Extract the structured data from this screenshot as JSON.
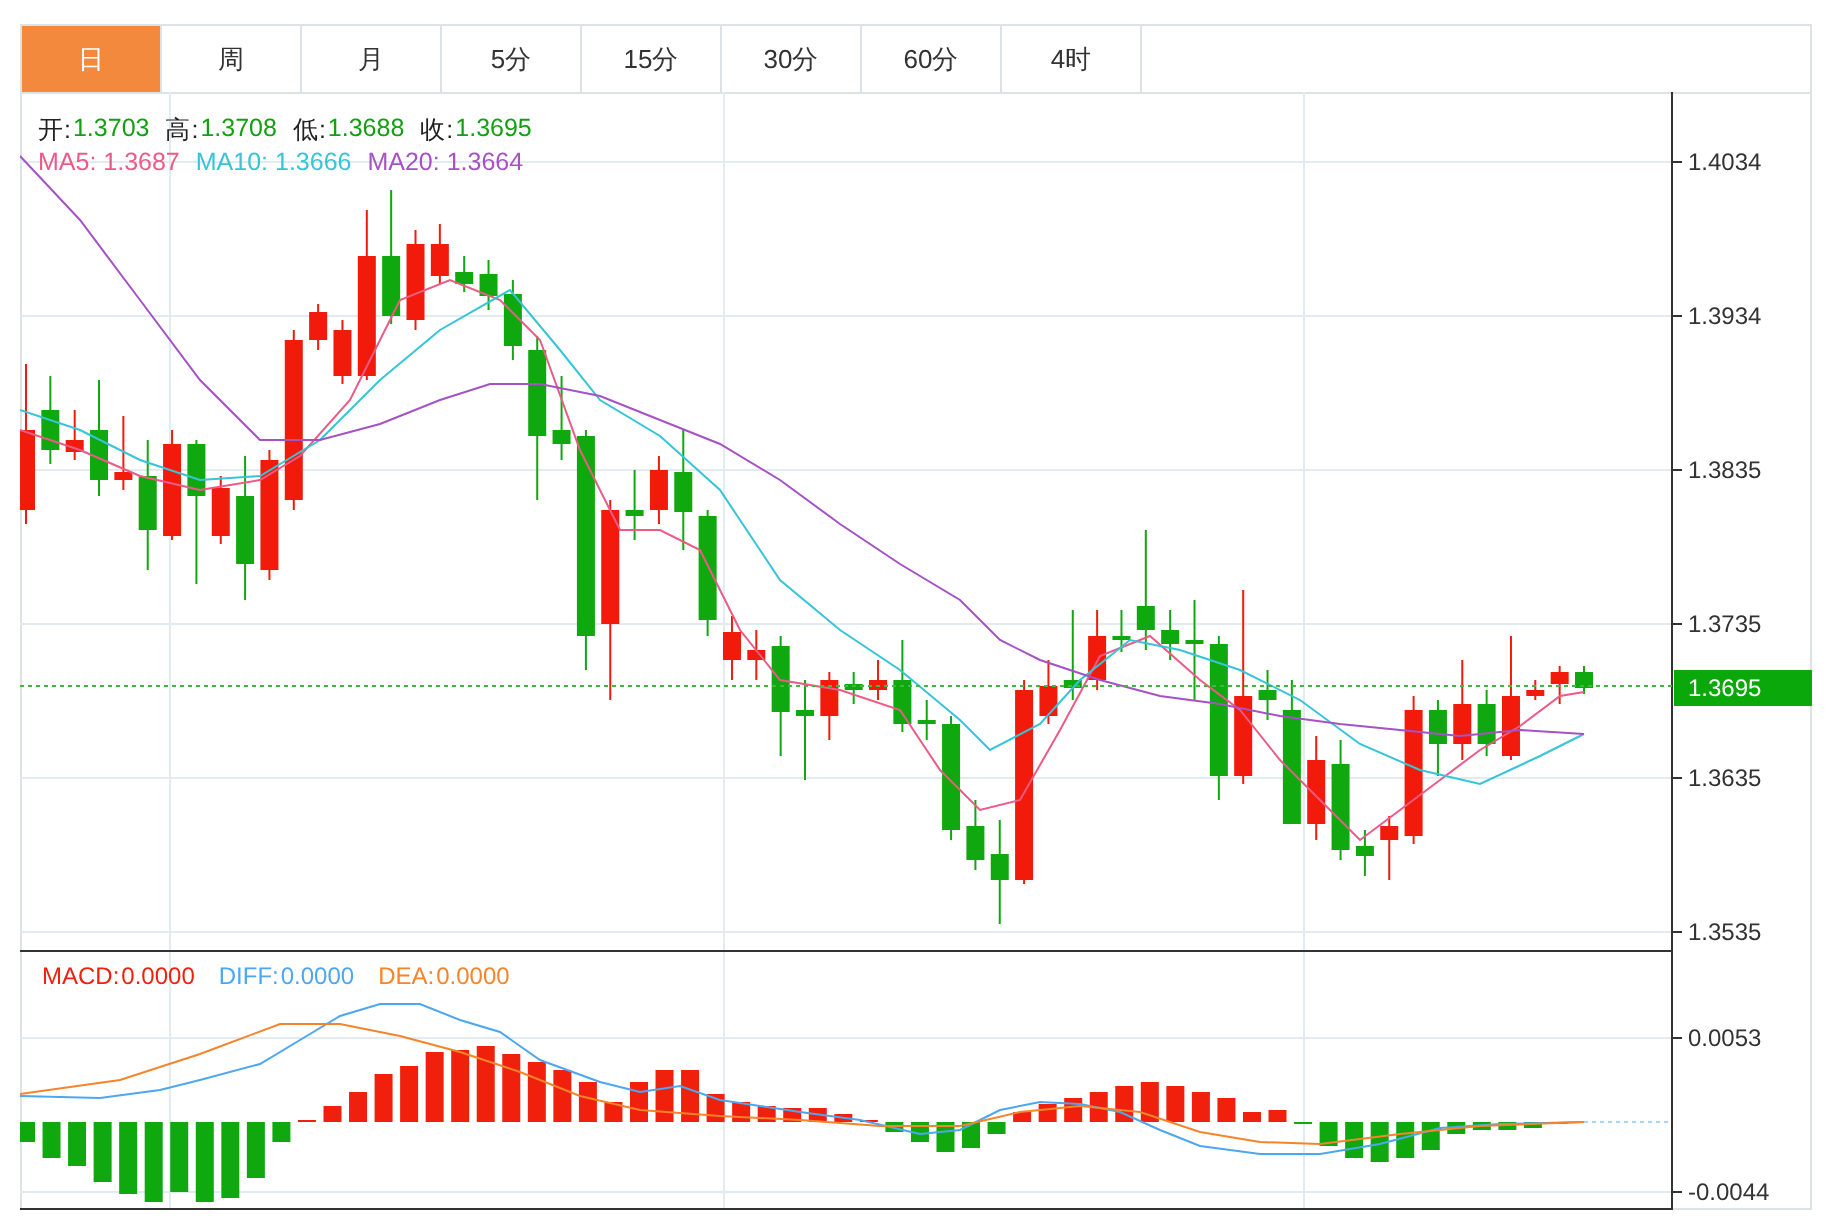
{
  "tabs": [
    {
      "label": "日",
      "selected": true
    },
    {
      "label": "周",
      "selected": false
    },
    {
      "label": "月",
      "selected": false
    },
    {
      "label": "5分",
      "selected": false
    },
    {
      "label": "15分",
      "selected": false
    },
    {
      "label": "30分",
      "selected": false
    },
    {
      "label": "60分",
      "selected": false
    },
    {
      "label": "4时",
      "selected": false
    }
  ],
  "price_chart": {
    "ohlc_legend": [
      {
        "label": "开:",
        "value": "1.3703"
      },
      {
        "label": "高:",
        "value": "1.3708"
      },
      {
        "label": "低:",
        "value": "1.3688"
      },
      {
        "label": "收:",
        "value": "1.3695"
      }
    ],
    "ma_legend": [
      {
        "label": "MA5:",
        "value": "1.3687",
        "color": "#ec5a86"
      },
      {
        "label": "MA10:",
        "value": "1.3666",
        "color": "#35c4d8"
      },
      {
        "label": "MA20:",
        "value": "1.3664",
        "color": "#a651c4"
      }
    ],
    "y_axis_labels": [
      "1.4034",
      "1.3934",
      "1.3835",
      "1.3735",
      "1.3635",
      "1.3535"
    ],
    "current_price": "1.3695"
  },
  "macd_chart": {
    "legend": [
      {
        "label": "MACD:",
        "value": "0.0000",
        "color": "#f0200c"
      },
      {
        "label": "DIFF:",
        "value": "0.0000",
        "color": "#4da6f0"
      },
      {
        "label": "DEA:",
        "value": "0.0000",
        "color": "#f5842a"
      }
    ],
    "y_axis_labels": [
      "0.0053",
      "-0.0044"
    ]
  }
}
